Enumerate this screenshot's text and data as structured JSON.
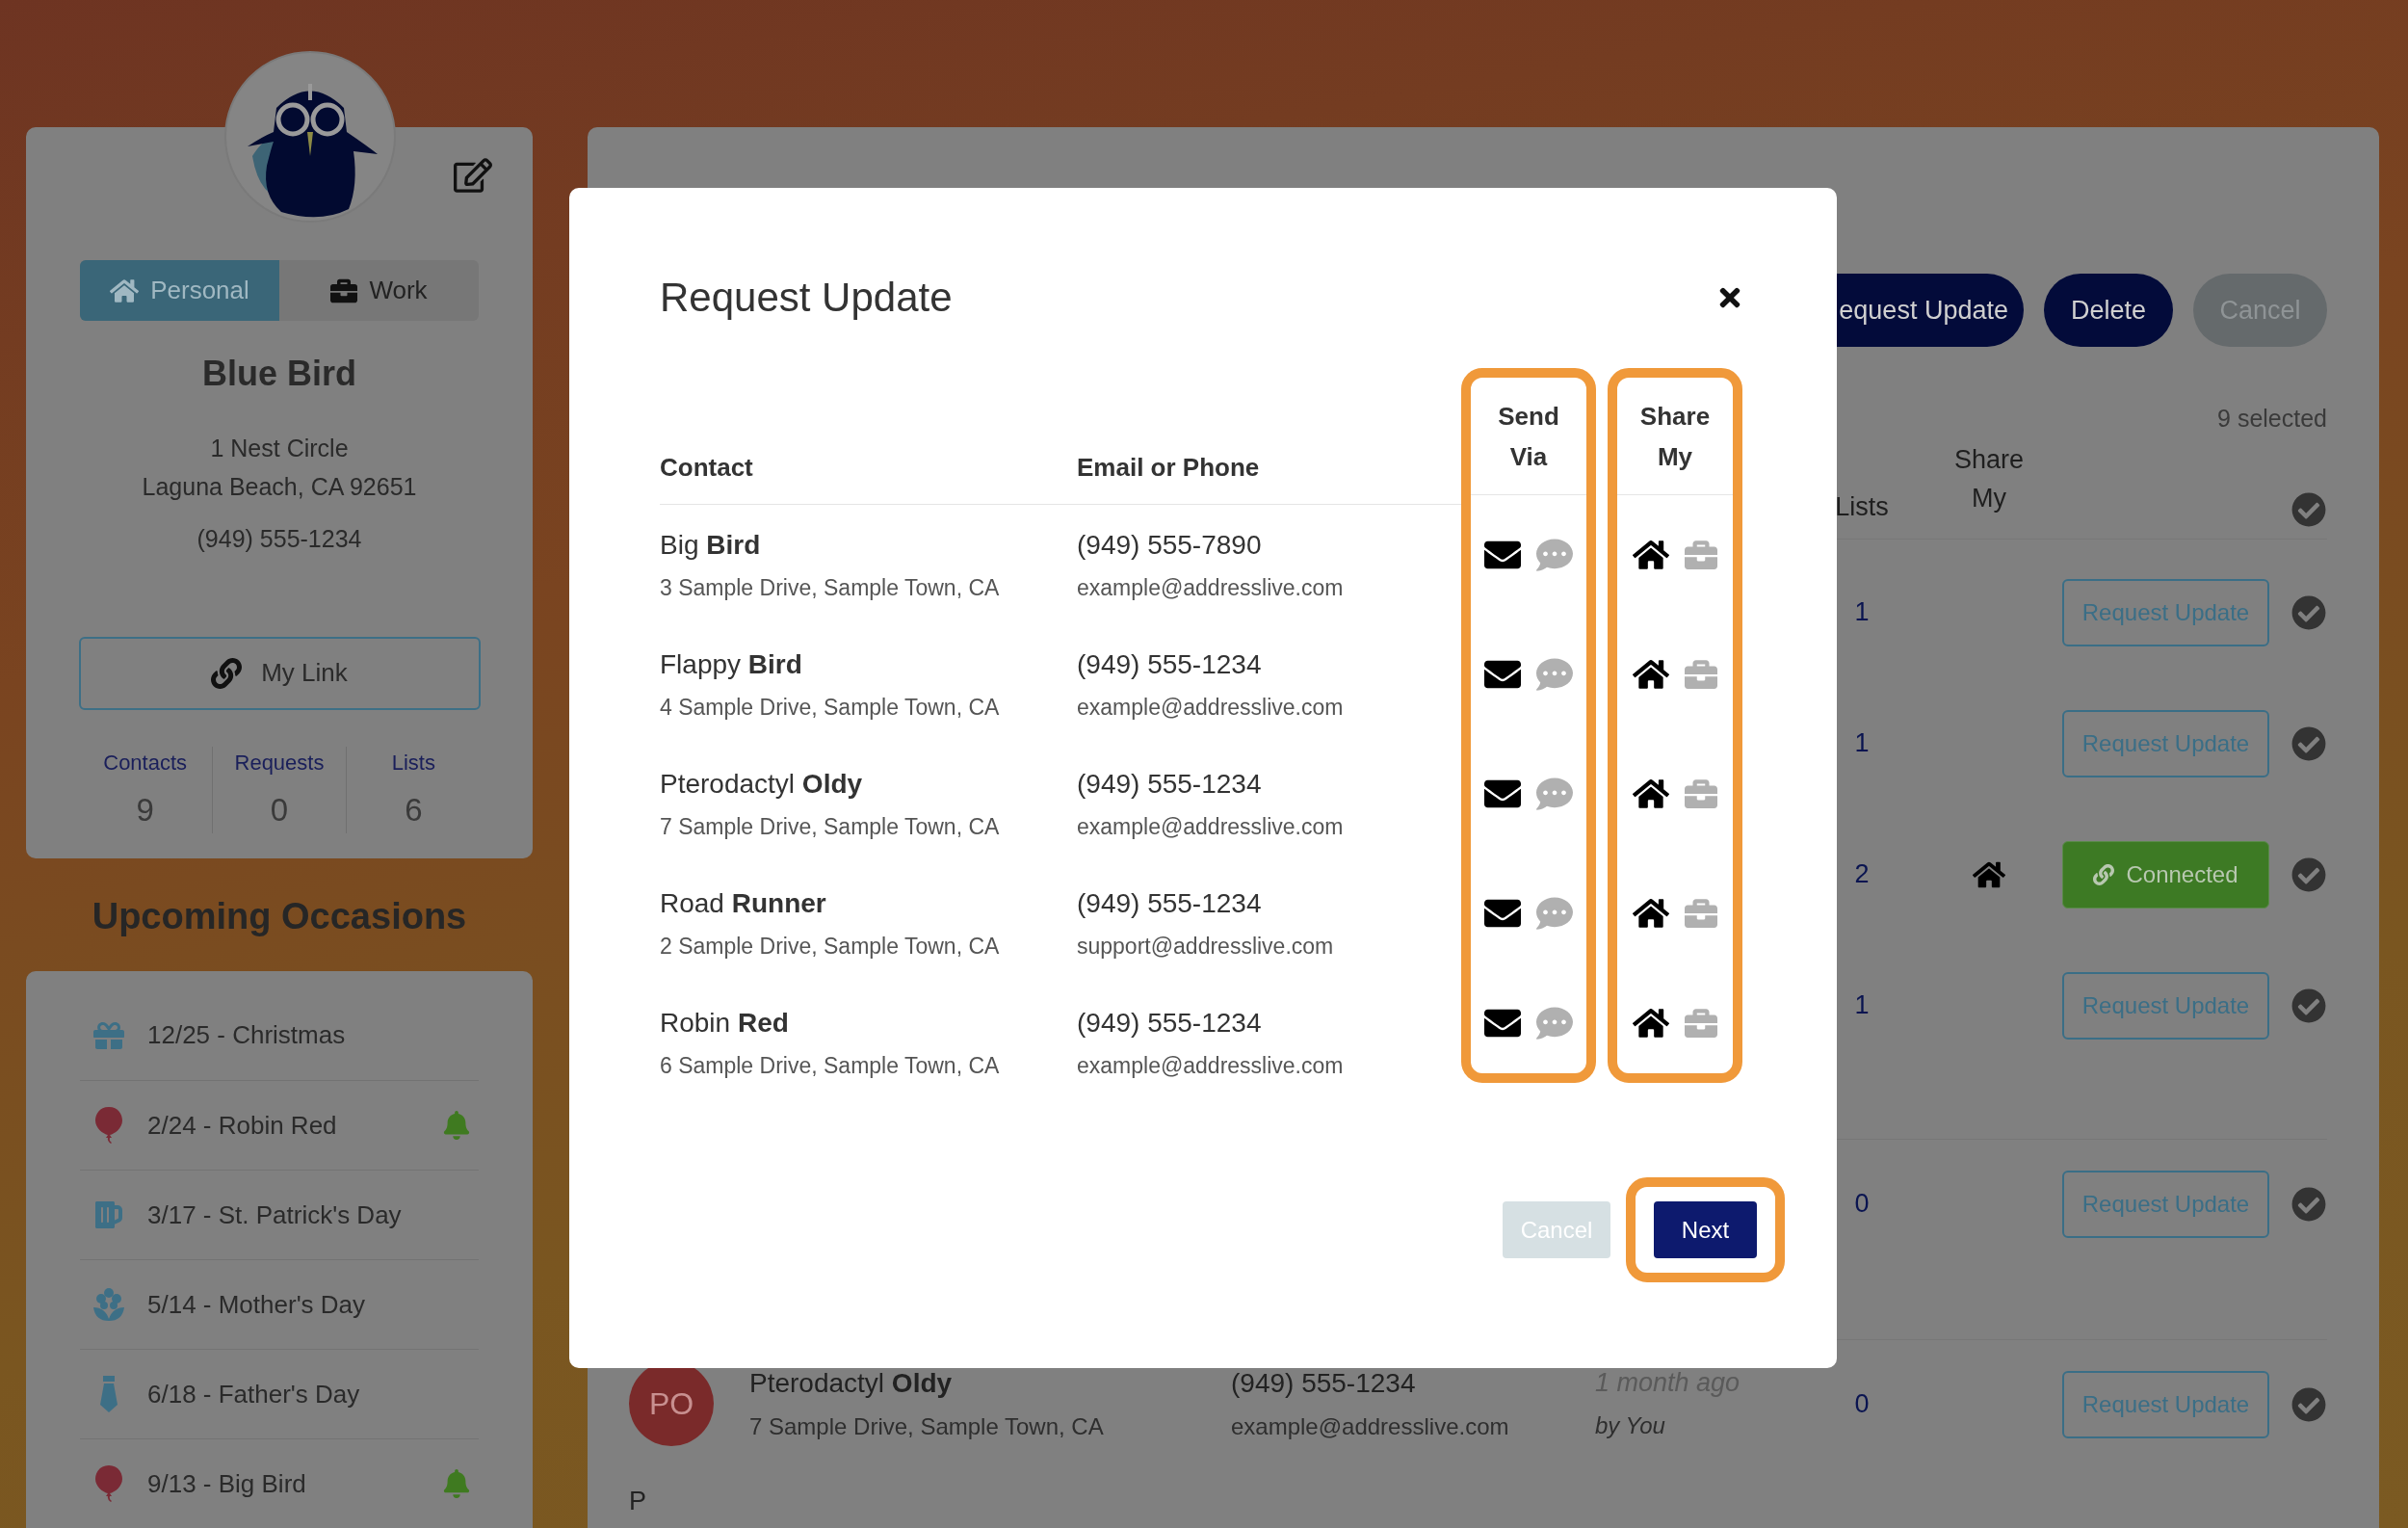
{
  "profile": {
    "tabs": [
      {
        "label": "Personal",
        "kind": "home",
        "selected": true
      },
      {
        "label": "Work",
        "kind": "work",
        "selected": false
      }
    ],
    "name": "Blue Bird",
    "address_lines": [
      "1 Nest Circle",
      "Laguna Beach, CA 92651"
    ],
    "phone": "(949) 555-1234",
    "link_button": "My Link",
    "stats": [
      {
        "label": "Contacts",
        "value": "9"
      },
      {
        "label": "Requests",
        "value": "0"
      },
      {
        "label": "Lists",
        "value": "6"
      }
    ]
  },
  "occasions": {
    "title": "Upcoming Occasions",
    "items": [
      {
        "kind": "gift",
        "text": "12/25 - Christmas",
        "reminder": false
      },
      {
        "kind": "balloon",
        "text": "2/24 - Robin Red",
        "reminder": true
      },
      {
        "kind": "mug",
        "text": "3/17 - St. Patrick's Day",
        "reminder": false
      },
      {
        "kind": "flower",
        "text": "5/14 - Mother's Day",
        "reminder": false
      },
      {
        "kind": "tie",
        "text": "6/18 - Father's Day",
        "reminder": false
      },
      {
        "kind": "balloon",
        "text": "9/13 - Big Bird",
        "reminder": true
      }
    ]
  },
  "contacts_panel": {
    "toolbar": [
      {
        "label": "equest Update",
        "kind": "primary"
      },
      {
        "label": "Delete",
        "kind": "primary"
      },
      {
        "label": "Cancel",
        "kind": "disabled"
      }
    ],
    "selection_count": "9 selected",
    "columns": [
      {
        "label": "Lists"
      },
      {
        "label": "Share My"
      }
    ],
    "header_checked": true,
    "rows": [
      {
        "lists": "1",
        "share_home": false,
        "action": {
          "kind": "request",
          "label": "Request Update"
        },
        "checked": true
      },
      {
        "lists": "1",
        "share_home": false,
        "action": {
          "kind": "request",
          "label": "Request Update"
        },
        "checked": true
      },
      {
        "lists": "2",
        "share_home": true,
        "action": {
          "kind": "connected",
          "label": "Connected"
        },
        "checked": true
      },
      {
        "lists": "1",
        "share_home": false,
        "action": {
          "kind": "request",
          "label": "Request Update"
        },
        "checked": true
      },
      {
        "lists": "0",
        "share_home": false,
        "action": {
          "kind": "request",
          "label": "Request Update"
        },
        "checked": true
      },
      {
        "lists": "0",
        "share_home": false,
        "action": {
          "kind": "request",
          "label": "Request Update"
        },
        "checked": true,
        "contact": {
          "initials": "PO",
          "name": "Pterodactyl **Oldy**",
          "address": "7 Sample Drive, Sample Town, CA",
          "phone": "(949) 555-1234",
          "email": "example@addresslive.com",
          "time": "1 month ago",
          "by": "by You"
        }
      }
    ],
    "group_letter": "P"
  },
  "modal": {
    "title": "Request Update",
    "columns": [
      {
        "label": "Contact"
      },
      {
        "label": "Email or Phone"
      },
      {
        "label": "Send Via",
        "highlighted": true
      },
      {
        "label": "Share My",
        "highlighted": true
      }
    ],
    "rows": [
      {
        "name": "Big **Bird**",
        "address": "3 Sample Drive, Sample Town, CA",
        "phone": "(949) 555-7890",
        "email": "example@addresslive.com",
        "send_via": [
          {
            "kind": "email",
            "selected": true
          },
          {
            "kind": "text",
            "selected": false
          }
        ],
        "share": [
          {
            "kind": "home",
            "selected": true
          },
          {
            "kind": "work",
            "selected": false
          }
        ]
      },
      {
        "name": "Flappy **Bird**",
        "address": "4 Sample Drive, Sample Town, CA",
        "phone": "(949) 555-1234",
        "email": "example@addresslive.com",
        "send_via": [
          {
            "kind": "email",
            "selected": true
          },
          {
            "kind": "text",
            "selected": false
          }
        ],
        "share": [
          {
            "kind": "home",
            "selected": true
          },
          {
            "kind": "work",
            "selected": false
          }
        ]
      },
      {
        "name": "Pterodactyl **Oldy**",
        "address": "7 Sample Drive, Sample Town, CA",
        "phone": "(949) 555-1234",
        "email": "example@addresslive.com",
        "send_via": [
          {
            "kind": "email",
            "selected": true
          },
          {
            "kind": "text",
            "selected": false
          }
        ],
        "share": [
          {
            "kind": "home",
            "selected": true
          },
          {
            "kind": "work",
            "selected": false
          }
        ]
      },
      {
        "name": "Road **Runner**",
        "address": "2 Sample Drive, Sample Town, CA",
        "phone": "(949) 555-1234",
        "email": "support@addresslive.com",
        "send_via": [
          {
            "kind": "email",
            "selected": true
          },
          {
            "kind": "text",
            "selected": false
          }
        ],
        "share": [
          {
            "kind": "home",
            "selected": true
          },
          {
            "kind": "work",
            "selected": false
          }
        ]
      },
      {
        "name": "Robin **Red**",
        "address": "6 Sample Drive, Sample Town, CA",
        "phone": "(949) 555-1234",
        "email": "example@addresslive.com",
        "send_via": [
          {
            "kind": "email",
            "selected": true
          },
          {
            "kind": "text",
            "selected": false
          }
        ],
        "share": [
          {
            "kind": "home",
            "selected": true
          },
          {
            "kind": "work",
            "selected": false
          }
        ]
      }
    ],
    "buttons": [
      {
        "label": "Cancel",
        "kind": "secondary",
        "highlighted": false
      },
      {
        "label": "Next",
        "kind": "primary",
        "highlighted": true
      }
    ]
  }
}
